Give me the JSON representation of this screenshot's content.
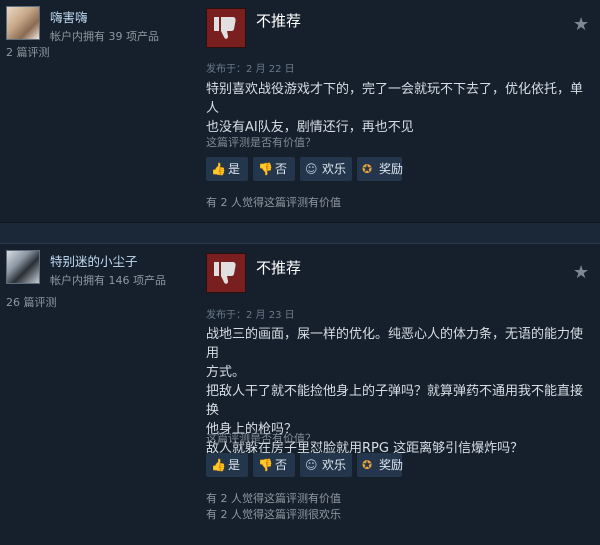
{
  "reviews": [
    {
      "user": "嗨害嗨",
      "products": "帐户内拥有 39 项产品",
      "review_count": "2 篇评测",
      "verdict": "不推荐",
      "posted": "发布于：2 月 22 日",
      "body_lines": [
        "特别喜欢战役游戏才下的，完了一会就玩不下去了，优化依托，单人",
        "也没有AI队友，剧情还行，再也不见"
      ],
      "helpful_question": "这篇评测是否有价值？",
      "buttons": {
        "yes": "是",
        "no": "否",
        "funny": "欢乐",
        "award": "奖励"
      },
      "counts": [
        "有 2 人觉得这篇评测有价值"
      ]
    },
    {
      "user": "特别迷的小尘子",
      "products": "帐户内拥有 146 项产品",
      "review_count": "26 篇评测",
      "verdict": "不推荐",
      "posted": "发布于：2 月 23 日",
      "body_lines": [
        "战地三的画面，屎一样的优化。纯恶心人的体力条，无语的能力使用",
        "方式。",
        "把敌人干了就不能捡他身上的子弹吗？就算弹药不通用我不能直接换",
        "他身上的枪吗？",
        "敌人就躲在房子里怼脸就用RPG 这距离够引信爆炸吗？"
      ],
      "helpful_question": "这篇评测是否有价值？",
      "buttons": {
        "yes": "是",
        "no": "否",
        "funny": "欢乐",
        "award": "奖励"
      },
      "counts": [
        "有 2 人觉得这篇评测有价值",
        "有 2 人觉得这篇评测很欢乐"
      ]
    }
  ],
  "icons": {
    "thumb_down": "thumbs-down-icon",
    "star": "star-icon",
    "yes": "thumbs-up-icon",
    "no": "thumbs-down-icon",
    "funny": "smiley-icon",
    "award": "award-icon"
  },
  "colors": {
    "not_recommended": "#7a1f1f",
    "username": "#c1dbf4",
    "award": "#e8a23a"
  }
}
